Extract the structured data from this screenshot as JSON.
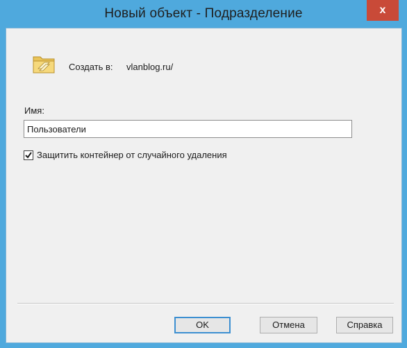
{
  "window": {
    "title": "Новый объект - Подразделение",
    "close_label": "x"
  },
  "info": {
    "create_in_label": "Создать в:",
    "create_in_value": "vlanblog.ru/"
  },
  "form": {
    "name_label": "Имя:",
    "name_value": "Пользователи",
    "protect_label": "Защитить контейнер от случайного удаления",
    "protect_checked": true
  },
  "buttons": {
    "ok": "OK",
    "cancel": "Отмена",
    "help": "Справка"
  },
  "icons": {
    "folder": "folder-icon",
    "close": "close-icon",
    "check": "check-icon"
  },
  "colors": {
    "titlebar": "#4fa9dd",
    "close": "#c94a38",
    "client": "#f0f0f0",
    "default_button_border": "#3c8fd1"
  }
}
